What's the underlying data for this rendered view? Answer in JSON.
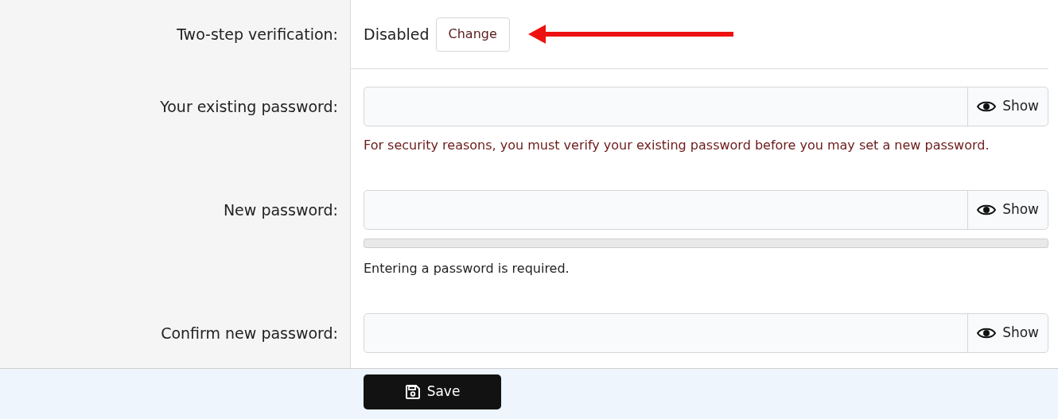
{
  "two_step": {
    "label": "Two-step verification:",
    "status": "Disabled",
    "button": "Change"
  },
  "fields": [
    {
      "label": "Your existing password:",
      "show": "Show",
      "hint": "For security reasons, you must verify your existing password before you may set a new password.",
      "kind": "error"
    },
    {
      "label": "New password:",
      "show": "Show",
      "meter": {
        "level": 0
      },
      "hint": "Entering a password is required.",
      "kind": "info"
    },
    {
      "label": "Confirm new password:",
      "show": "Show"
    }
  ],
  "save": "Save"
}
